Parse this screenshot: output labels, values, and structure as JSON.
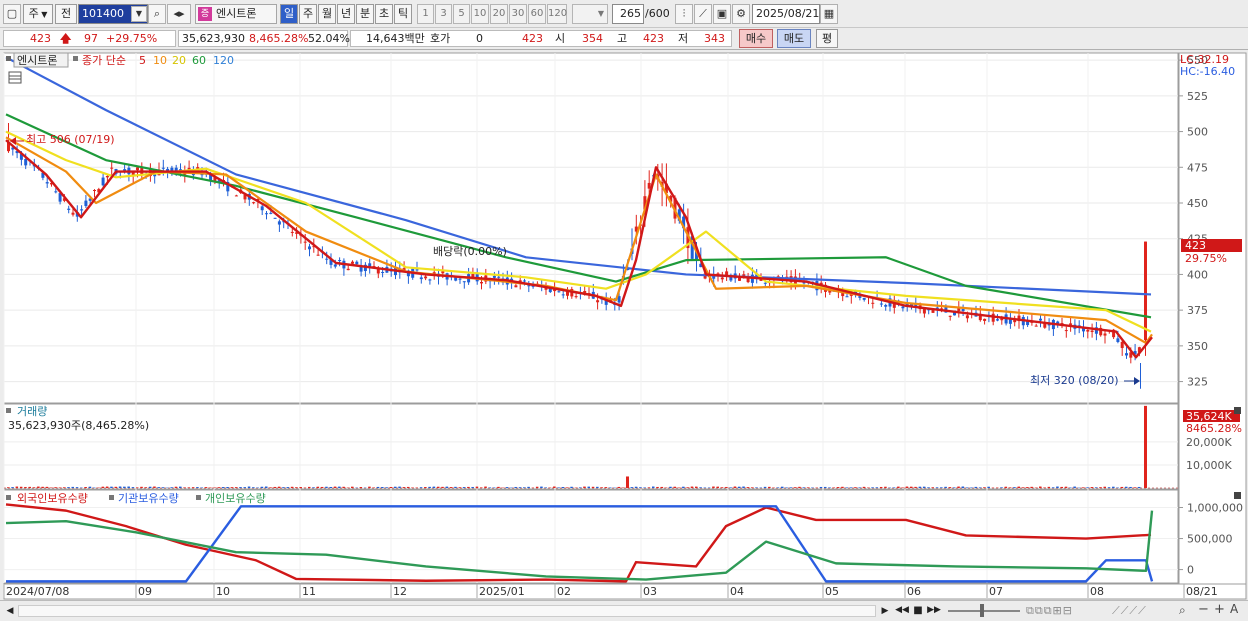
{
  "toolbar": {
    "period_type": "주",
    "prefix": "전",
    "code": "101400",
    "stock_name": "엔시트론",
    "name_badge": "증",
    "periods": [
      "일",
      "주",
      "월",
      "년",
      "분",
      "초",
      "틱"
    ],
    "minute_options": [
      "1",
      "3",
      "5",
      "10",
      "20",
      "30",
      "60",
      "120"
    ],
    "count": "265",
    "count_max": "/600",
    "date": "2025/08/21"
  },
  "quote": {
    "price": "423",
    "change": "97",
    "change_pct": "+29.75%",
    "volume": "35,623,930",
    "volume_pct": "8,465.28%",
    "turnover": "52.04%",
    "amount": "14,643백만",
    "hoga_label": "호가",
    "hoga_value": "0",
    "bid": "423",
    "open_label": "시",
    "open": "354",
    "high_label": "고",
    "high": "423",
    "low_label": "저",
    "low": "343",
    "buy_label": "매수",
    "sell_label": "매도",
    "eval_label": "평"
  },
  "price_panel": {
    "name_tag": "엔시트론",
    "legend_label": "종가 단순",
    "ma_periods": [
      "5",
      "10",
      "20",
      "60",
      "120"
    ],
    "lc": "LC:32.19",
    "hc": "HC:-16.40",
    "y_ticks": [
      "550",
      "525",
      "500",
      "475",
      "450",
      "425",
      "400",
      "375",
      "350",
      "325"
    ],
    "current_price_tag": "423",
    "current_pct_tag": "29.75%",
    "high_annot": "최고 506 (07/19)",
    "low_annot": "최저 320 (08/20)",
    "dividend_annot": "배당락(0.00%)"
  },
  "volume_panel": {
    "title": "거래량",
    "value_text": "35,623,930주(8,465.28%)",
    "tag_value": "35,624K",
    "tag_pct": "8465.28%",
    "y_ticks": [
      "20,000K",
      "10,000K"
    ]
  },
  "holdings_panel": {
    "legend": [
      "외국인보유수량",
      "기관보유수량",
      "개인보유수량"
    ],
    "y_ticks": [
      "1,000,000",
      "500,000",
      "0"
    ]
  },
  "x_axis": {
    "labels": [
      "2024/07/08",
      "09",
      "10",
      "11",
      "12",
      "2025/01",
      "02",
      "03",
      "04",
      "05",
      "06",
      "07",
      "08",
      "08/21"
    ]
  },
  "colors": {
    "candle_up": "#e0241d",
    "candle_down": "#1f5fd6",
    "ma5": "#d01818",
    "ma10": "#f08c10",
    "ma20": "#f0e020",
    "ma60": "#1e9a3a",
    "ma120": "#3a66dc",
    "foreign": "#d01818",
    "institution": "#2a5de0",
    "individual": "#2f9a57"
  },
  "chart_data": [
    {
      "type": "candlestick",
      "title": "엔시트론",
      "ylim": [
        310,
        555
      ],
      "x_labels": [
        "2024/07/08",
        "09",
        "10",
        "11",
        "12",
        "2025/01",
        "02",
        "03",
        "04",
        "05",
        "06",
        "07",
        "08",
        "08/21"
      ],
      "key_points": [
        {
          "x": "2024/07/19",
          "high": 506
        },
        {
          "x": "2025/08/20",
          "low": 320
        },
        {
          "x": "2025/08/21",
          "open": 354,
          "high": 423,
          "low": 343,
          "close": 423
        }
      ],
      "ma_anchors": {
        "ma120": [
          [
            0,
            552
          ],
          [
            100,
            515
          ],
          [
            230,
            470
          ],
          [
            400,
            438
          ],
          [
            520,
            412
          ],
          [
            680,
            400
          ],
          [
            900,
            394
          ],
          [
            1145,
            386
          ]
        ],
        "ma60": [
          [
            0,
            512
          ],
          [
            100,
            480
          ],
          [
            230,
            462
          ],
          [
            350,
            440
          ],
          [
            500,
            412
          ],
          [
            610,
            395
          ],
          [
            680,
            410
          ],
          [
            880,
            412
          ],
          [
            960,
            392
          ],
          [
            1145,
            370
          ]
        ],
        "ma20": [
          [
            0,
            500
          ],
          [
            60,
            480
          ],
          [
            110,
            468
          ],
          [
            200,
            474
          ],
          [
            300,
            450
          ],
          [
            400,
            405
          ],
          [
            520,
            398
          ],
          [
            600,
            390
          ],
          [
            640,
            400
          ],
          [
            700,
            430
          ],
          [
            760,
            395
          ],
          [
            900,
            385
          ],
          [
            1100,
            375
          ],
          [
            1145,
            360
          ]
        ],
        "ma10": [
          [
            0,
            496
          ],
          [
            60,
            472
          ],
          [
            90,
            450
          ],
          [
            150,
            472
          ],
          [
            220,
            470
          ],
          [
            300,
            430
          ],
          [
            400,
            402
          ],
          [
            540,
            392
          ],
          [
            610,
            382
          ],
          [
            650,
            470
          ],
          [
            710,
            390
          ],
          [
            800,
            392
          ],
          [
            900,
            380
          ],
          [
            1100,
            368
          ],
          [
            1140,
            352
          ],
          [
            1146,
            358
          ]
        ],
        "ma5": [
          [
            0,
            494
          ],
          [
            40,
            470
          ],
          [
            75,
            440
          ],
          [
            110,
            472
          ],
          [
            200,
            472
          ],
          [
            260,
            448
          ],
          [
            330,
            408
          ],
          [
            420,
            400
          ],
          [
            500,
            396
          ],
          [
            590,
            385
          ],
          [
            615,
            378
          ],
          [
            630,
            410
          ],
          [
            650,
            475
          ],
          [
            680,
            440
          ],
          [
            700,
            400
          ],
          [
            740,
            398
          ],
          [
            800,
            395
          ],
          [
            900,
            378
          ],
          [
            1110,
            360
          ],
          [
            1130,
            342
          ],
          [
            1146,
            356
          ]
        ]
      }
    },
    {
      "type": "bar",
      "title": "거래량",
      "ylim": [
        0,
        36000
      ],
      "y_unit": "K",
      "notable_bars": [
        {
          "x": "2025/03",
          "value": 5000
        },
        {
          "x": "2025/08/21",
          "value": 35624
        }
      ]
    },
    {
      "type": "line",
      "title": "보유수량",
      "ylim": [
        -200000,
        1250000
      ],
      "series": [
        {
          "name": "외국인보유수량",
          "anchors": [
            [
              0,
              1050000
            ],
            [
              60,
              950000
            ],
            [
              120,
              700000
            ],
            [
              180,
              400000
            ],
            [
              250,
              150000
            ],
            [
              290,
              -150000
            ],
            [
              420,
              -180000
            ],
            [
              540,
              -160000
            ],
            [
              620,
              -190000
            ],
            [
              630,
              120000
            ],
            [
              690,
              50000
            ],
            [
              720,
              700000
            ],
            [
              760,
              1000000
            ],
            [
              810,
              800000
            ],
            [
              900,
              800000
            ],
            [
              960,
              550000
            ],
            [
              1080,
              500000
            ],
            [
              1145,
              560000
            ]
          ]
        },
        {
          "name": "기관보유수량",
          "anchors": [
            [
              0,
              -190000
            ],
            [
              180,
              -190000
            ],
            [
              235,
              1020000
            ],
            [
              700,
              1020000
            ],
            [
              770,
              1020000
            ],
            [
              820,
              -190000
            ],
            [
              1080,
              -190000
            ],
            [
              1100,
              150000
            ],
            [
              1140,
              150000
            ],
            [
              1146,
              -190000
            ]
          ]
        },
        {
          "name": "개인보유수량",
          "anchors": [
            [
              0,
              750000
            ],
            [
              60,
              780000
            ],
            [
              130,
              600000
            ],
            [
              230,
              280000
            ],
            [
              320,
              240000
            ],
            [
              420,
              50000
            ],
            [
              540,
              -110000
            ],
            [
              620,
              -150000
            ],
            [
              640,
              -160000
            ],
            [
              720,
              -50000
            ],
            [
              760,
              450000
            ],
            [
              830,
              100000
            ],
            [
              950,
              50000
            ],
            [
              1080,
              20000
            ],
            [
              1140,
              -20000
            ],
            [
              1146,
              950000
            ]
          ]
        }
      ]
    }
  ]
}
